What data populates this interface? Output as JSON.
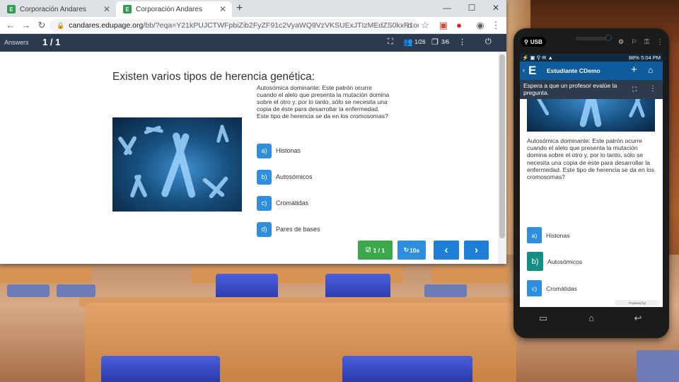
{
  "browser": {
    "tabs": [
      {
        "title": "Corporación Andares",
        "active": false
      },
      {
        "title": "Corporación Andares",
        "active": true
      }
    ],
    "url_host": "candares.edupage.org",
    "url_path": "/bb/?eqa=Y21kPUJCTWFpbiZib2FyZF91c2VyaWQ9VzVKSUExJTIzMEdZS0kxR1omdXNlcl9..."
  },
  "app": {
    "answers_label": "Answers",
    "counter": "1 / 1",
    "students": "1/26",
    "slides": "3/6"
  },
  "question": {
    "title": "Existen varios tipos de herencia genética:",
    "text": "Autosómica dominante: Este patrón ocurre cuando el alelo que presenta la mutación domina sobre el otro y, por lo tanto, sólo se necesita una copia de éste para desarrollar la enfermedad. Este tipo de herencia se da en los cromosomas?",
    "options": [
      {
        "letter": "a)",
        "label": "Histonas"
      },
      {
        "letter": "b)",
        "label": "Autosómicos"
      },
      {
        "letter": "c)",
        "label": "Cromátidas"
      },
      {
        "letter": "d)",
        "label": "Pares de bases"
      }
    ]
  },
  "nav": {
    "answered": "1 / 1",
    "timer": "10s",
    "prev": "‹",
    "next": "›"
  },
  "phone": {
    "usb_label": "USB",
    "status_right": "88% 5:04 PM",
    "app_title": "Estudiante CDemo",
    "wait_message": "Espera a que un profesor evalúe la pregunta.",
    "text": "Autosómica dominante: Este patrón ocurre cuando el alelo que presenta la mutación domina sobre el otro y, por lo tanto, sólo se necesita una copia de éste para desarrollar la enfermedad. Este tipo de herencia se da en los cromosomas?",
    "selected_option": "b)",
    "powered_by": "Powered by"
  },
  "colors": {
    "appbar": "#2b3a4e",
    "option_badge": "#2f8fdc",
    "selected_badge": "#138f83",
    "answered_button": "#3aa84b",
    "timer_button": "#2f8fdc",
    "nav_button": "#1f7fd6",
    "phone_appbar": "#0f5b9c"
  }
}
